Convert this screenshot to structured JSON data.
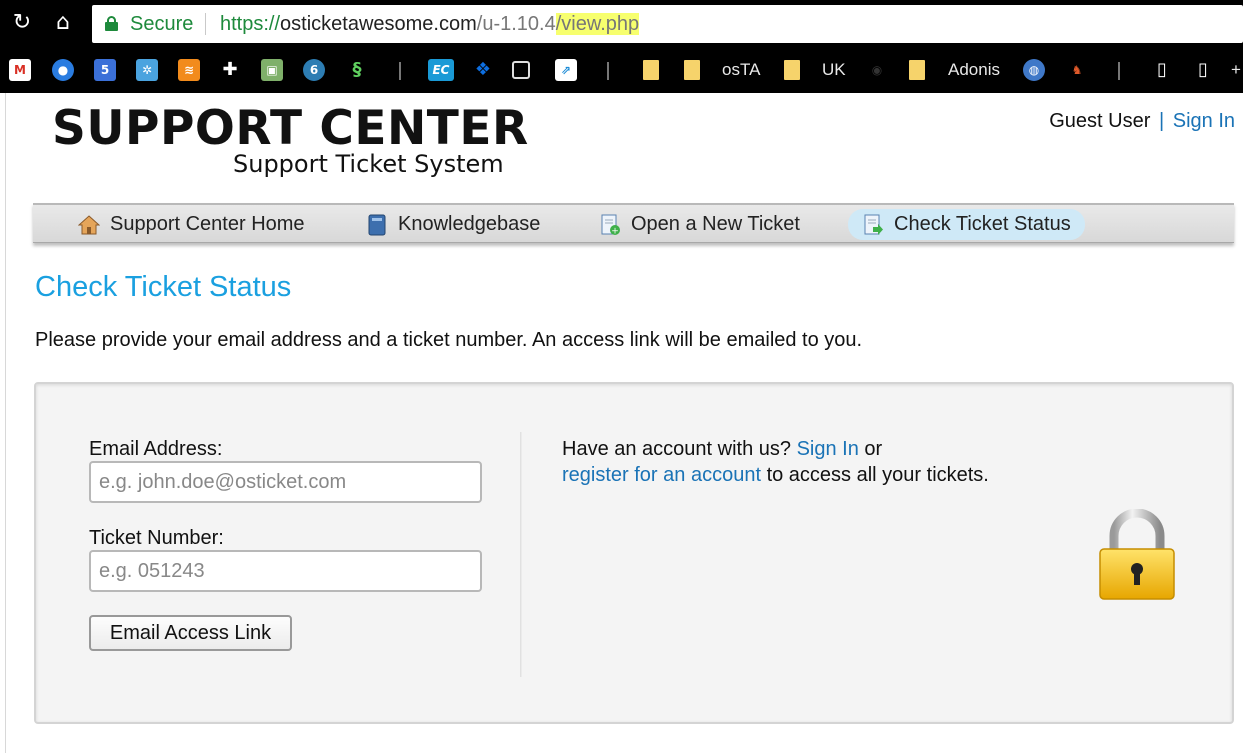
{
  "browser": {
    "secure_label": "Secure",
    "url_scheme": "https://",
    "url_host": "osticketawesome.com",
    "url_path": "/u-1.10.4",
    "url_highlight": "/view.php",
    "highlight_color": "#f7ff6e",
    "bookmarks": [
      {
        "icon": "gmail-icon"
      },
      {
        "icon": "contacts-icon"
      },
      {
        "icon": "calendar-icon",
        "text": "5"
      },
      {
        "icon": "gear-map-icon"
      },
      {
        "icon": "feed-icon"
      },
      {
        "icon": "extensions-puzzle-icon"
      },
      {
        "icon": "photo-icon"
      },
      {
        "icon": "badge-icon",
        "text": "6"
      },
      {
        "icon": "spiral-icon"
      },
      {
        "icon": "ec-icon",
        "text": "EC"
      },
      {
        "icon": "dropbox-icon"
      },
      {
        "icon": "square-icon"
      },
      {
        "icon": "arrow-icon"
      },
      {
        "icon": "folder-icon",
        "label": ""
      },
      {
        "icon": "folder-icon",
        "label": "osTA"
      },
      {
        "icon": "folder-icon",
        "label": "UK"
      },
      {
        "icon": "folder-icon",
        "label": "Adonis"
      },
      {
        "icon": "globe-icon"
      },
      {
        "icon": "mascot-icon"
      },
      {
        "icon": "page-icon"
      },
      {
        "icon": "page-icon"
      }
    ],
    "overflow": "+"
  },
  "header": {
    "logo_title": "SUPPORT CENTER",
    "logo_subtitle": "Support Ticket System",
    "guest_user": "Guest User",
    "separator": "|",
    "sign_in": "Sign In"
  },
  "nav": {
    "items": [
      {
        "label": "Support Center Home",
        "icon": "home-icon"
      },
      {
        "label": "Knowledgebase",
        "icon": "book-icon"
      },
      {
        "label": "Open a New Ticket",
        "icon": "new-ticket-icon"
      },
      {
        "label": "Check Ticket Status",
        "icon": "ticket-status-icon",
        "active": true
      }
    ]
  },
  "main": {
    "title": "Check Ticket Status",
    "intro": "Please provide your email address and a ticket number. An access link will be emailed to you.",
    "form": {
      "email_label": "Email Address:",
      "email_placeholder": "e.g. john.doe@osticket.com",
      "email_value": "",
      "ticket_label": "Ticket Number:",
      "ticket_placeholder": "e.g. 051243",
      "ticket_value": "",
      "submit_label": "Email Access Link"
    },
    "account": {
      "prefix": "Have an account with us?",
      "sign_in": "Sign In",
      "or": "or",
      "register_link": "register for an account",
      "suffix": "to access all your tickets."
    }
  },
  "colors": {
    "title_blue": "#1aa0e0",
    "link_blue": "#1a73b6",
    "secure_green": "#1e8a3c",
    "active_tab": "#cfe9f7"
  }
}
